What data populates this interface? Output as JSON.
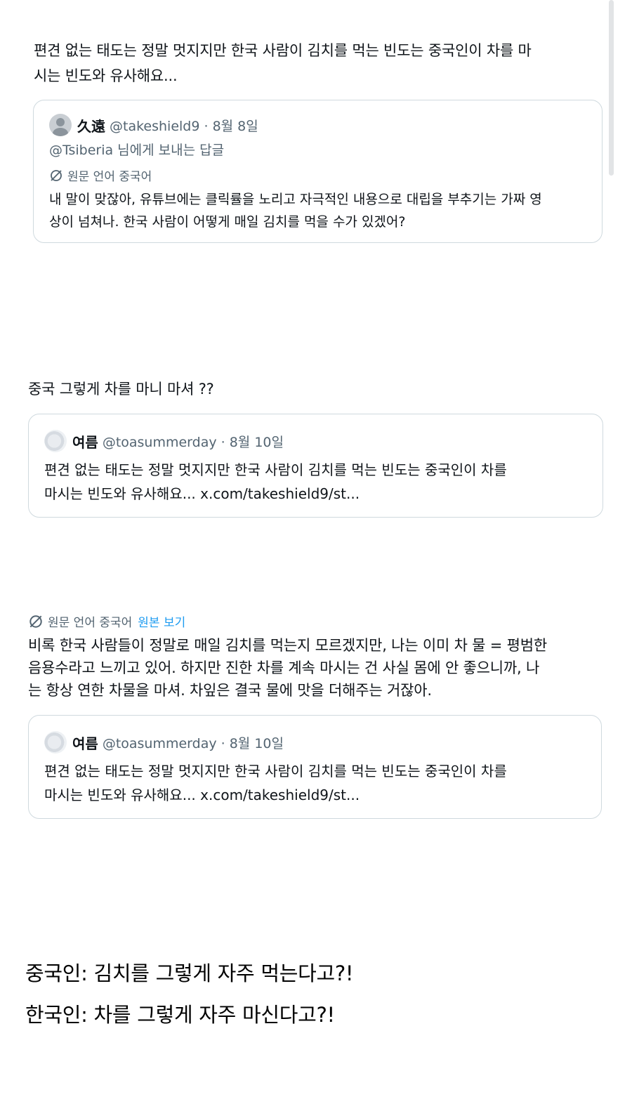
{
  "post1": {
    "text_line1": "편견 없는 태도는 정말 멋지지만 한국 사람이 김치를 먹는 빈도는 중국인이 차를 마",
    "text_line2": "시는 빈도와 유사해요...",
    "quote": {
      "name": "久遠",
      "handle": "@takeshield9 · 8월 8일",
      "reply_to": "@Tsiberia 님에게 보내는 답글",
      "translation_label": "원문 언어 중국어",
      "text_line1": "내 말이 맞잖아, 유튜브에는 클릭률을 노리고 자극적인 내용으로 대립을 부추기는 가짜 영",
      "text_line2": "상이 넘쳐나. 한국 사람이 어떻게 매일 김치를 먹을 수가 있겠어?"
    }
  },
  "post2": {
    "text": "중국 그렇게 차를 마니 마셔 ??",
    "quote": {
      "name": "여름",
      "handle": "@toasummerday · 8월 10일",
      "text_line1": "편견 없는 태도는 정말 멋지지만 한국 사람이 김치를 먹는 빈도는 중국인이 차를",
      "text_line2": "마시는 빈도와 유사해요... x.com/takeshield9/st..."
    }
  },
  "post3": {
    "translation_label": "원문 언어 중국어",
    "show_original": "원본 보기",
    "text_line1": "비록 한국 사람들이 정말로 매일 김치를 먹는지 모르겠지만, 나는 이미 차 물 = 평범한",
    "text_line2": "음용수라고 느끼고 있어. 하지만 진한 차를 계속 마시는 건 사실 몸에 안 좋으니까, 나",
    "text_line3": "는 항상 연한 차물을 마셔. 차잎은 결국 물에 맛을 더해주는 거잖아.",
    "quote": {
      "name": "여름",
      "handle": "@toasummerday · 8월 10일",
      "text_line1": "편견 없는 태도는 정말 멋지지만 한국 사람이 김치를 먹는 빈도는 중국인이 차를",
      "text_line2": "마시는 빈도와 유사해요... x.com/takeshield9/st..."
    }
  },
  "caption": {
    "line1": "중국인: 김치를 그렇게 자주 먹는다고?!",
    "line2": "한국인: 차를 그렇게 자주 마신다고?!"
  },
  "colors": {
    "link": "#1d9bf0",
    "muted": "#536471",
    "border": "#cfd9de"
  }
}
